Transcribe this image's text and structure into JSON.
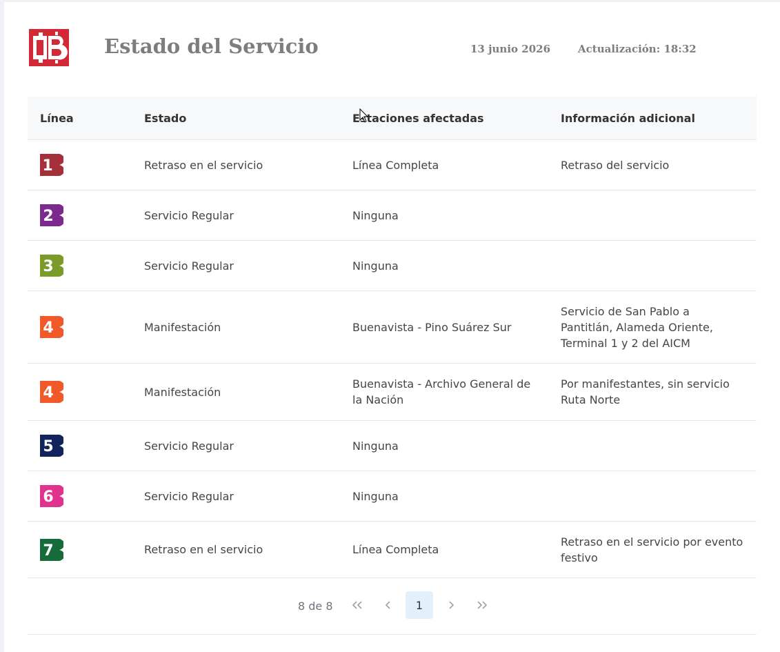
{
  "header": {
    "logo_text": "MB",
    "title": "Estado del Servicio",
    "date": "13 junio 2026",
    "update": "Actualización: 18:32"
  },
  "table": {
    "columns": [
      "Línea",
      "Estado",
      "Estaciones afectadas",
      "Información adicional"
    ],
    "rows": [
      {
        "line": "1",
        "line_color": "#a6303a",
        "status": "Retraso en el servicio",
        "stations": "Línea Completa",
        "info": "Retraso del servicio"
      },
      {
        "line": "2",
        "line_color": "#7b2a8e",
        "status": "Servicio Regular",
        "stations": "Ninguna",
        "info": ""
      },
      {
        "line": "3",
        "line_color": "#7a9a2a",
        "status": "Servicio Regular",
        "stations": "Ninguna",
        "info": ""
      },
      {
        "line": "4",
        "line_color": "#f05a2a",
        "status": "Manifestación",
        "stations": "Buenavista - Pino Suárez Sur",
        "info": "Servicio de San Pablo a Pantitlán, Alameda Oriente, Terminal 1 y 2 del AICM"
      },
      {
        "line": "4",
        "line_color": "#f05a2a",
        "status": "Manifestación",
        "stations": "Buenavista - Archivo General de la Nación",
        "info": "Por manifestantes, sin servicio Ruta Norte"
      },
      {
        "line": "5",
        "line_color": "#13235c",
        "status": "Servicio Regular",
        "stations": "Ninguna",
        "info": ""
      },
      {
        "line": "6",
        "line_color": "#e0338f",
        "status": "Servicio Regular",
        "stations": "Ninguna",
        "info": ""
      },
      {
        "line": "7",
        "line_color": "#156b3a",
        "status": "Retraso en el servicio",
        "stations": "Línea Completa",
        "info": "Retraso en el servicio por evento festivo"
      }
    ]
  },
  "pagination": {
    "info": "8 de 8",
    "first": "«",
    "prev": "‹",
    "current": "1",
    "next": "›",
    "last": "»"
  },
  "colors": {
    "brand_red": "#d12a36",
    "header_bg": "#f7f8fa",
    "current_page_bg": "#e1f0fb"
  }
}
